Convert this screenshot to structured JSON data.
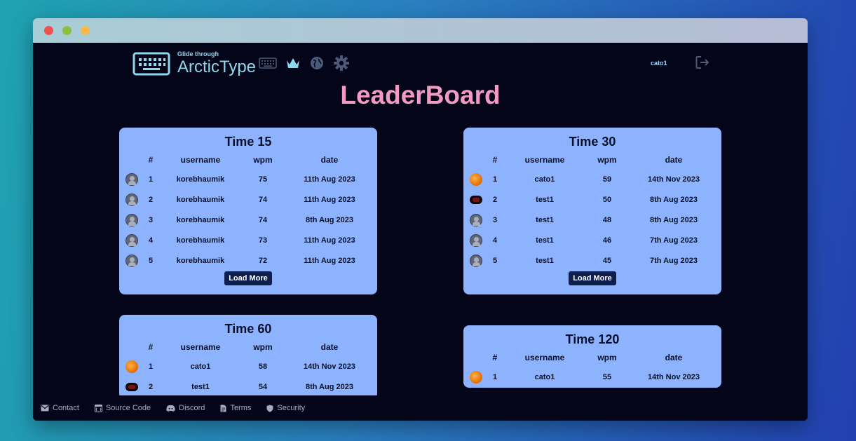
{
  "app": {
    "tagline": "Glide through",
    "name": "ArcticType",
    "user": "cato1"
  },
  "icons": [
    "keyboard-logo-icon",
    "keyboard-icon",
    "crown-icon",
    "globe-icon",
    "gear-icon",
    "logout-icon"
  ],
  "page": {
    "title": "LeaderBoard"
  },
  "columns": {
    "rank": "#",
    "username": "username",
    "wpm": "wpm",
    "date": "date"
  },
  "boards": [
    {
      "title": "Time 15",
      "load_more": "Load More",
      "rows": [
        {
          "avatar": "default",
          "rank": "1",
          "username": "korebhaumik",
          "wpm": "75",
          "date": "11th Aug 2023"
        },
        {
          "avatar": "default",
          "rank": "2",
          "username": "korebhaumik",
          "wpm": "74",
          "date": "11th Aug 2023"
        },
        {
          "avatar": "default",
          "rank": "3",
          "username": "korebhaumik",
          "wpm": "74",
          "date": "8th Aug 2023"
        },
        {
          "avatar": "default",
          "rank": "4",
          "username": "korebhaumik",
          "wpm": "73",
          "date": "11th Aug 2023"
        },
        {
          "avatar": "default",
          "rank": "5",
          "username": "korebhaumik",
          "wpm": "72",
          "date": "11th Aug 2023"
        }
      ]
    },
    {
      "title": "Time 30",
      "load_more": "Load More",
      "rows": [
        {
          "avatar": "orange",
          "rank": "1",
          "username": "cato1",
          "wpm": "59",
          "date": "14th Nov 2023"
        },
        {
          "avatar": "goggle",
          "rank": "2",
          "username": "test1",
          "wpm": "50",
          "date": "8th Aug 2023"
        },
        {
          "avatar": "default",
          "rank": "3",
          "username": "test1",
          "wpm": "48",
          "date": "8th Aug 2023"
        },
        {
          "avatar": "default",
          "rank": "4",
          "username": "test1",
          "wpm": "46",
          "date": "7th Aug 2023"
        },
        {
          "avatar": "default",
          "rank": "5",
          "username": "test1",
          "wpm": "45",
          "date": "7th Aug 2023"
        }
      ]
    },
    {
      "title": "Time 60",
      "rows": [
        {
          "avatar": "orange",
          "rank": "1",
          "username": "cato1",
          "wpm": "58",
          "date": "14th Nov 2023"
        },
        {
          "avatar": "goggle",
          "rank": "2",
          "username": "test1",
          "wpm": "54",
          "date": "8th Aug 2023"
        }
      ]
    },
    {
      "title": "Time 120",
      "rows": [
        {
          "avatar": "orange",
          "rank": "1",
          "username": "cato1",
          "wpm": "55",
          "date": "14th Nov 2023"
        }
      ]
    }
  ],
  "footer": [
    {
      "label": "Contact",
      "icon": "mail-icon"
    },
    {
      "label": "Source Code",
      "icon": "code-icon"
    },
    {
      "label": "Discord",
      "icon": "discord-icon"
    },
    {
      "label": "Terms",
      "icon": "document-icon"
    },
    {
      "label": "Security",
      "icon": "shield-icon"
    }
  ],
  "colors": {
    "background": "#050519",
    "accent": "#8ed7ee",
    "title": "#f39ac3",
    "card": "#8db3ff",
    "button": "#0d1f4f"
  }
}
